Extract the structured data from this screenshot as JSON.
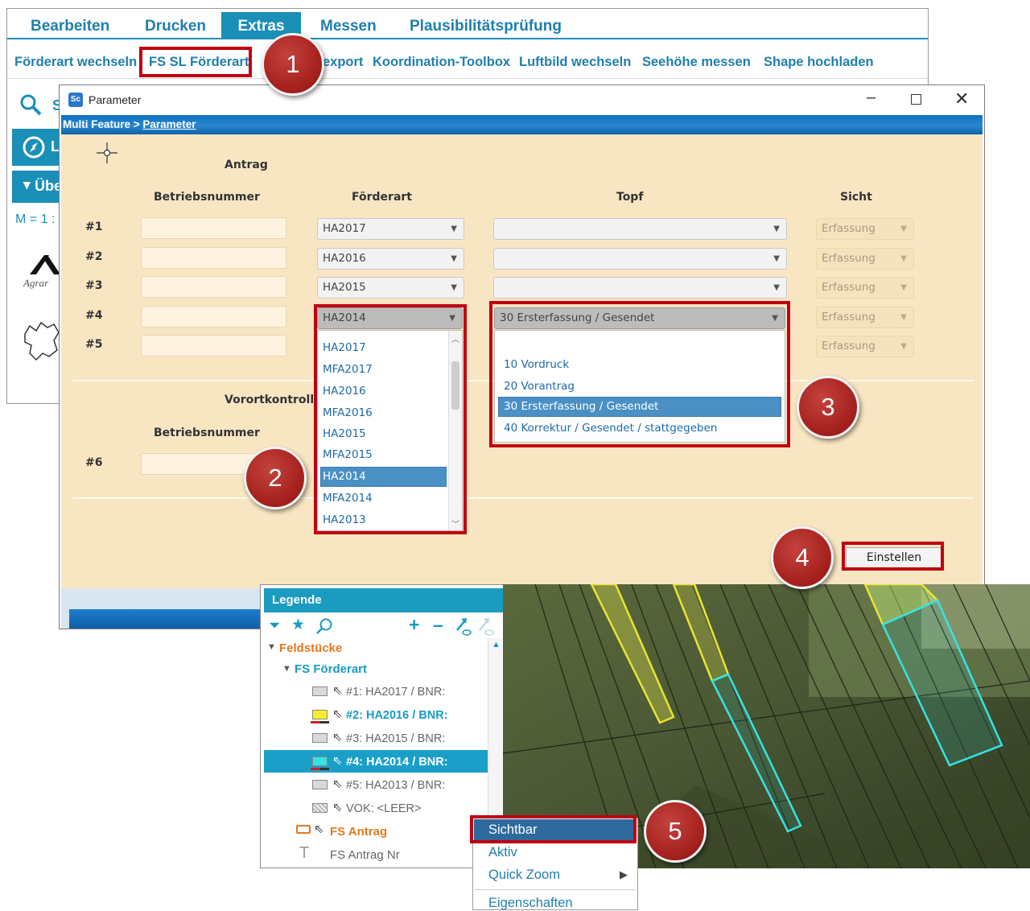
{
  "app": {
    "menu": [
      "Bearbeiten",
      "Drucken",
      "Extras",
      "Messen",
      "Plausibilitätsprüfung"
    ],
    "active_menu": "Extras",
    "toolbar": [
      "Förderart wechseln",
      "FS SL Förderart",
      "export",
      "Koordination-Toolbox",
      "Luftbild wechseln",
      "Seehöhe messen",
      "Shape hochladen"
    ],
    "side_snippets": {
      "search_letter": "S",
      "nav_letter": "L",
      "overview": "Übe",
      "scale": "M = 1 :",
      "logo_text": "Agrar"
    }
  },
  "dialog": {
    "app_icon": "Sc",
    "title": "Parameter",
    "breadcrumb_root": "Multi Feature",
    "breadcrumb_sep": " > ",
    "breadcrumb_current": "Parameter",
    "section_antrag": "Antrag",
    "col_betriebsnummer": "Betriebsnummer",
    "col_foerderart": "Förderart",
    "col_topf": "Topf",
    "col_sicht": "Sicht",
    "rows": [
      {
        "label": "#1",
        "foerderart": "HA2017",
        "topf": "",
        "sicht": "Erfassung"
      },
      {
        "label": "#2",
        "foerderart": "HA2016",
        "topf": "",
        "sicht": "Erfassung"
      },
      {
        "label": "#3",
        "foerderart": "HA2015",
        "topf": "",
        "sicht": "Erfassung"
      },
      {
        "label": "#4",
        "foerderart": "HA2014",
        "topf": "30 Ersterfassung / Gesendet",
        "sicht": "Erfassung"
      },
      {
        "label": "#5",
        "foerderart": "",
        "topf": "",
        "sicht": "Erfassung"
      }
    ],
    "section_vok": "Vorortkontrolle",
    "vok_betriebsnummer": "Betriebsnummer",
    "vok_row": "#6",
    "foerderart_options": [
      "HA2017",
      "MFA2017",
      "HA2016",
      "MFA2016",
      "HA2015",
      "MFA2015",
      "HA2014",
      "MFA2014",
      "HA2013"
    ],
    "foerderart_selected": "HA2014",
    "topf_options": [
      "10 Vordruck",
      "20 Vorantrag",
      "30 Ersterfassung / Gesendet",
      "40 Korrektur / Gesendet / stattgegeben"
    ],
    "topf_selected": "30 Ersterfassung / Gesendet",
    "submit": "Einstellen"
  },
  "legend": {
    "title": "Legende",
    "group": "Feldstücke",
    "subgroup": "FS Förderart",
    "items": [
      {
        "text": "#1: HA2017 / BNR:",
        "color": "#d9d9d9",
        "bold": false
      },
      {
        "text": "#2: HA2016 / BNR:",
        "color": "#f5ef2a",
        "bold": true
      },
      {
        "text": "#3: HA2015 / BNR:",
        "color": "#d9d9d9",
        "bold": false
      },
      {
        "text": "#4: HA2014 / BNR:",
        "color": "#35e3e3",
        "bold": true
      },
      {
        "text": "#5: HA2013 / BNR:",
        "color": "#d9d9d9",
        "bold": false
      },
      {
        "text": "VOK: <LEER>",
        "color": "#d9d9d9",
        "bold": false
      }
    ],
    "antrag": "FS Antrag",
    "antrag_nr": "FS Antrag Nr"
  },
  "context_menu": [
    "Sichtbar",
    "Aktiv",
    "Quick Zoom",
    "Eigenschaften"
  ],
  "badges": [
    "1",
    "2",
    "3",
    "4",
    "5"
  ],
  "colors": {
    "accent": "#1a8fb8",
    "highlight": "#c00010",
    "panel": "#f8e6c3"
  }
}
